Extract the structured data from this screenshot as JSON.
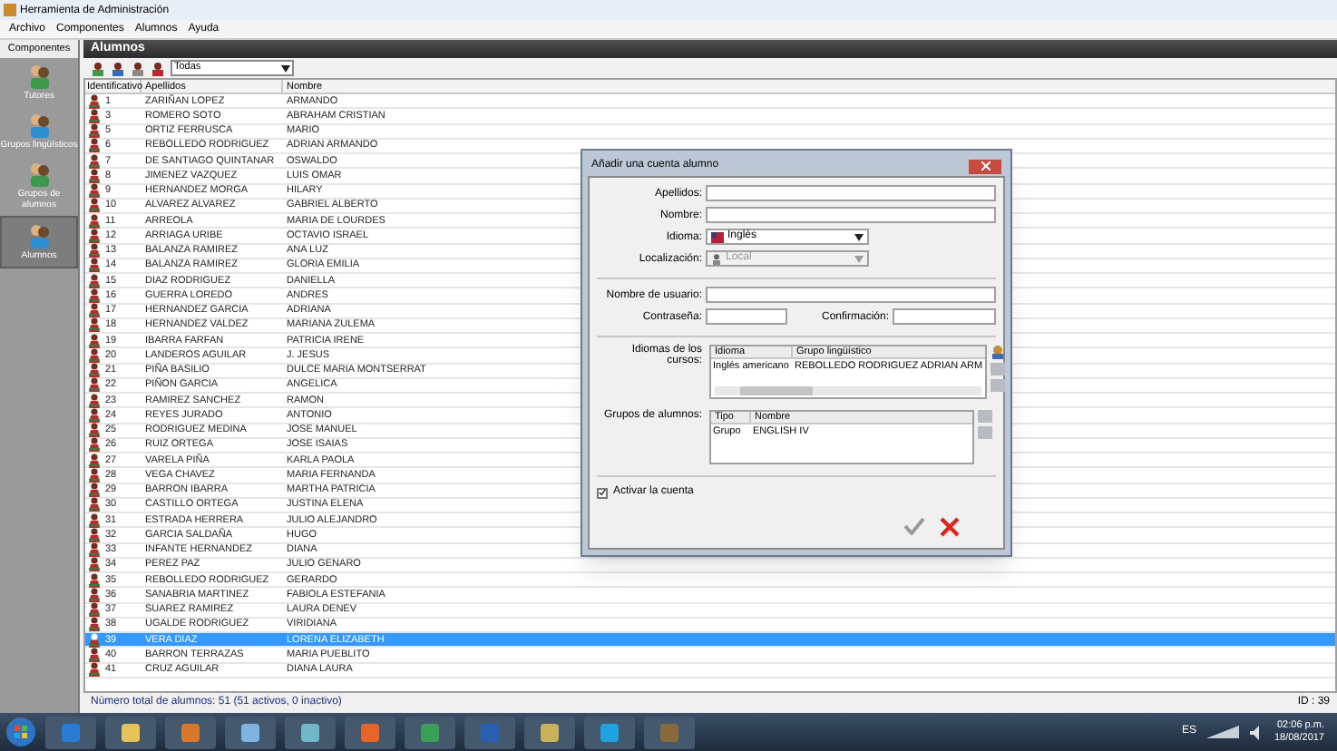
{
  "window": {
    "title": "Herramienta de Administración"
  },
  "menu": [
    "Archivo",
    "Componentes",
    "Alumnos",
    "Ayuda"
  ],
  "sidebar": {
    "header": "Componentes",
    "items": [
      {
        "label": "Tutores",
        "selected": false
      },
      {
        "label": "Grupos lingüísticos",
        "selected": false
      },
      {
        "label": "Grupos de alumnos",
        "selected": false
      },
      {
        "label": "Alumnos",
        "selected": true
      }
    ]
  },
  "panel": {
    "title": "Alumnos",
    "filter": "Todas"
  },
  "table": {
    "columns": [
      "Identificativo",
      "Apellidos",
      "Nombre"
    ],
    "rows": [
      {
        "id": "1",
        "apellidos": "ZARIÑAN LOPEZ",
        "nombre": "ARMANDO",
        "selected": false
      },
      {
        "id": "3",
        "apellidos": "ROMERO SOTO",
        "nombre": "ABRAHAM CRISTIAN",
        "selected": false
      },
      {
        "id": "5",
        "apellidos": "ORTIZ FERRUSCA",
        "nombre": "MARIO",
        "selected": false
      },
      {
        "id": "6",
        "apellidos": "REBOLLEDO RODRIGUEZ",
        "nombre": "ADRIAN ARMANDO",
        "selected": false
      },
      {
        "id": "7",
        "apellidos": "DE SANTIAGO QUINTANAR",
        "nombre": "OSWALDO",
        "selected": false
      },
      {
        "id": "8",
        "apellidos": "JIMENEZ VAZQUEZ",
        "nombre": "LUIS OMAR",
        "selected": false
      },
      {
        "id": "9",
        "apellidos": "HERNANDEZ MORGA",
        "nombre": "HILARY",
        "selected": false
      },
      {
        "id": "10",
        "apellidos": "ALVAREZ ALVAREZ",
        "nombre": "GABRIEL ALBERTO",
        "selected": false
      },
      {
        "id": "11",
        "apellidos": "ARREOLA",
        "nombre": "MARIA DE LOURDES",
        "selected": false
      },
      {
        "id": "12",
        "apellidos": "ARRIAGA URIBE",
        "nombre": "OCTAVIO ISRAEL",
        "selected": false
      },
      {
        "id": "13",
        "apellidos": "BALANZA RAMIREZ",
        "nombre": "ANA LUZ",
        "selected": false
      },
      {
        "id": "14",
        "apellidos": "BALANZA RAMIREZ",
        "nombre": "GLORIA EMILIA",
        "selected": false
      },
      {
        "id": "15",
        "apellidos": "DIAZ RODRIGUEZ",
        "nombre": "DANIELLA",
        "selected": false
      },
      {
        "id": "16",
        "apellidos": "GUERRA LOREDO",
        "nombre": "ANDRES",
        "selected": false
      },
      {
        "id": "17",
        "apellidos": "HERNANDEZ GARCIA",
        "nombre": "ADRIANA",
        "selected": false
      },
      {
        "id": "18",
        "apellidos": "HERNANDEZ VALDEZ",
        "nombre": "MARIANA ZULEMA",
        "selected": false
      },
      {
        "id": "19",
        "apellidos": "IBARRA FARFAN",
        "nombre": "PATRICIA IRENE",
        "selected": false
      },
      {
        "id": "20",
        "apellidos": "LANDEROS AGUILAR",
        "nombre": "J. JESUS",
        "selected": false
      },
      {
        "id": "21",
        "apellidos": "PIÑA BASILIO",
        "nombre": "DULCE MARIA MONTSERRAT",
        "selected": false
      },
      {
        "id": "22",
        "apellidos": "PIÑON GARCIA",
        "nombre": "ANGELICA",
        "selected": false
      },
      {
        "id": "23",
        "apellidos": "RAMIREZ SANCHEZ",
        "nombre": "RAMON",
        "selected": false
      },
      {
        "id": "24",
        "apellidos": "REYES JURADO",
        "nombre": "ANTONIO",
        "selected": false
      },
      {
        "id": "25",
        "apellidos": "RODRIGUEZ MEDINA",
        "nombre": "JOSE MANUEL",
        "selected": false
      },
      {
        "id": "26",
        "apellidos": "RUIZ ORTEGA",
        "nombre": "JOSE ISAIAS",
        "selected": false
      },
      {
        "id": "27",
        "apellidos": "VARELA PIÑA",
        "nombre": "KARLA PAOLA",
        "selected": false
      },
      {
        "id": "28",
        "apellidos": "VEGA CHAVEZ",
        "nombre": "MARIA FERNANDA",
        "selected": false
      },
      {
        "id": "29",
        "apellidos": "BARRON IBARRA",
        "nombre": "MARTHA PATRICIA",
        "selected": false
      },
      {
        "id": "30",
        "apellidos": "CASTILLO ORTEGA",
        "nombre": "JUSTINA ELENA",
        "selected": false
      },
      {
        "id": "31",
        "apellidos": "ESTRADA HERRERA",
        "nombre": "JULIO ALEJANDRO",
        "selected": false
      },
      {
        "id": "32",
        "apellidos": "GARCIA SALDAÑA",
        "nombre": "HUGO",
        "selected": false
      },
      {
        "id": "33",
        "apellidos": "INFANTE HERNANDEZ",
        "nombre": "DIANA",
        "selected": false
      },
      {
        "id": "34",
        "apellidos": "PEREZ PAZ",
        "nombre": "JULIO GENARO",
        "selected": false
      },
      {
        "id": "35",
        "apellidos": "REBOLLEDO RODRIGUEZ",
        "nombre": "GERARDO",
        "selected": false
      },
      {
        "id": "36",
        "apellidos": "SANABRIA MARTINEZ",
        "nombre": "FABIOLA ESTEFANIA",
        "selected": false
      },
      {
        "id": "37",
        "apellidos": "SUAREZ RAMIREZ",
        "nombre": "LAURA DENEV",
        "selected": false
      },
      {
        "id": "38",
        "apellidos": "UGALDE RODRIGUEZ",
        "nombre": "VIRIDIANA",
        "selected": false
      },
      {
        "id": "39",
        "apellidos": "VERA DIAZ",
        "nombre": "LORENA ELIZABETH",
        "selected": true
      },
      {
        "id": "40",
        "apellidos": "BARRON TERRAZAS",
        "nombre": "MARIA PUEBLITO",
        "selected": false
      },
      {
        "id": "41",
        "apellidos": "CRUZ AGUILAR",
        "nombre": "DIANA LAURA",
        "selected": false
      }
    ]
  },
  "status_bar": {
    "total": "Número total de alumnos: 51 (51 activos, 0 inactivo)",
    "id": "ID : 39"
  },
  "dialog": {
    "title": "Añadir una cuenta alumno",
    "apellidos_label": "Apellidos:",
    "nombre_label": "Nombre:",
    "idioma_label": "Idioma:",
    "idioma": "Inglés",
    "localizacion_label": "Localización:",
    "localizacion": "Local",
    "localizacion_disabled": true,
    "usuario_label": "Nombre de usuario:",
    "contrasena_label": "Contraseña:",
    "confirmacion_label": "Confirmación:",
    "cursos": {
      "label": "Idiomas de los cursos:",
      "columns": [
        "Idioma",
        "Grupo lingüístico"
      ],
      "rows": [
        {
          "idioma": "Inglés americano",
          "grupo": "REBOLLEDO RODRIGUEZ ADRIAN ARM"
        }
      ]
    },
    "grupos": {
      "label": "Grupos de alumnos:",
      "columns": [
        "Tipo",
        "Nombre"
      ],
      "rows": [
        {
          "tipo": "Grupo",
          "nombre": "ENGLISH IV"
        }
      ]
    },
    "activar": {
      "label": "Activar la cuenta",
      "checked": true
    }
  },
  "taskbar": {
    "language": "ES",
    "time": "02:06 p.m.",
    "date": "18/08/2017"
  }
}
